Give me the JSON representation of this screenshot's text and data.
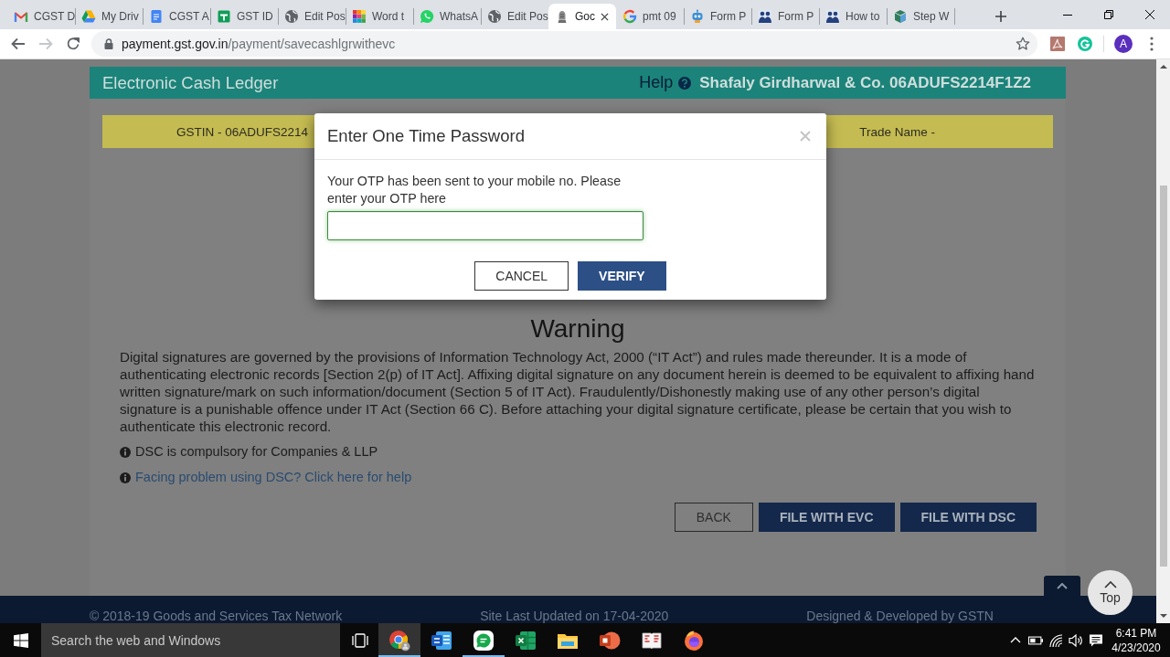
{
  "browser": {
    "tabs": [
      {
        "title": "CGST D",
        "selected": false
      },
      {
        "title": "My Driv",
        "selected": false
      },
      {
        "title": "CGST A",
        "selected": false
      },
      {
        "title": "GST ID",
        "selected": false
      },
      {
        "title": "Edit Pos",
        "selected": false
      },
      {
        "title": "Word t",
        "selected": false
      },
      {
        "title": "WhatsA",
        "selected": false
      },
      {
        "title": "Edit Pos",
        "selected": false
      },
      {
        "title": "Goc",
        "selected": true
      },
      {
        "title": "pmt 09",
        "selected": false
      },
      {
        "title": "Form P",
        "selected": false
      },
      {
        "title": "Form P",
        "selected": false
      },
      {
        "title": "How to",
        "selected": false
      },
      {
        "title": "Step W",
        "selected": false
      }
    ],
    "toolbar": {
      "back": {
        "disabled": false
      },
      "forward": {
        "disabled": true
      },
      "address": {
        "host": "payment.gst.gov.in",
        "path": "/payment/savecashlgrwithevc"
      },
      "profile": {
        "initial": "A"
      }
    }
  },
  "page": {
    "header": {
      "title": "Electronic Cash Ledger",
      "help": "Help",
      "taxpayer": "Shafaly Girdharwal & Co. 06ADUFS2214F1Z2"
    },
    "info_bar": {
      "gstin": "GSTIN - 06ADUFS2214",
      "trade_name": "Trade Name -"
    },
    "warning": {
      "heading": "Warning",
      "text": "Digital signatures are governed by the provisions of Information Technology Act, 2000 (“IT Act”) and rules made thereunder. It is a mode of authenticating electronic records [Section 2(p) of IT Act]. Affixing digital signature on any document herein is deemed to be equivalent to affixing hand written signature/mark on such information/document (Section 5 of IT Act). Fraudulently/Dishonestly making use of any other person’s digital signature is a punishable offence under IT Act (Section 66 C). Before attaching your digital signature certificate, please be certain that you wish to authenticate this electronic record.",
      "notes": [
        {
          "kind": "text",
          "text": "DSC is compulsory for Companies & LLP"
        },
        {
          "kind": "link",
          "text": "Facing problem using DSC? Click here for help"
        }
      ]
    },
    "actions": [
      {
        "label": "BACK",
        "kind": "outline"
      },
      {
        "label": "FILE WITH EVC",
        "kind": "primary"
      },
      {
        "label": "FILE WITH DSC",
        "kind": "primary"
      }
    ],
    "footer": {
      "copyright": "© 2018-19 Goods and Services Tax Network",
      "updated": "Site Last Updated on 17-04-2020",
      "credit": "Designed & Developed by GSTN"
    },
    "back_to_top": {
      "label": "Top"
    }
  },
  "dialog": {
    "title": "Enter One Time Password",
    "message": "Your OTP has been sent to your mobile no. Please enter your OTP here",
    "otp_field": {
      "focused": true
    },
    "buttons": [
      {
        "label": "CANCEL",
        "kind": "outline"
      },
      {
        "label": "VERIFY",
        "kind": "primary"
      }
    ]
  },
  "taskbar": {
    "search": {
      "placeholder": "Search the web and Windows"
    },
    "apps": [
      {
        "running": true,
        "selected": true
      },
      {
        "running": false,
        "selected": false
      },
      {
        "running": true,
        "selected": false
      },
      {
        "running": false,
        "selected": false
      },
      {
        "running": false,
        "selected": false
      },
      {
        "running": false,
        "selected": false
      },
      {
        "running": false,
        "selected": false
      },
      {
        "running": false,
        "selected": false
      }
    ],
    "clock": {
      "time": "6:41 PM",
      "date": "4/23/2020"
    }
  }
}
